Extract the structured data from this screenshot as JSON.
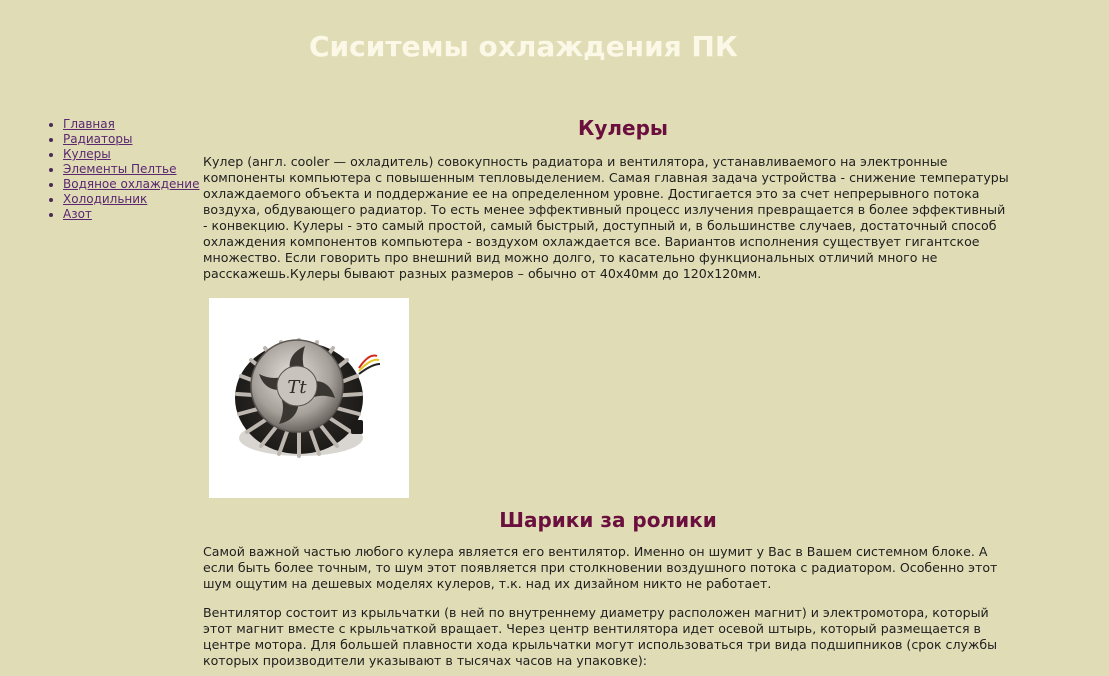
{
  "header": {
    "title": "Сиситемы охлаждения ПК"
  },
  "nav": {
    "items": [
      {
        "label": "Главная"
      },
      {
        "label": "Радиаторы"
      },
      {
        "label": "Кулеры"
      },
      {
        "label": "Элементы Пелтье"
      },
      {
        "label": "Водяное охлаждение"
      },
      {
        "label": "Холодильник"
      },
      {
        "label": "Азот"
      }
    ]
  },
  "main": {
    "section1": {
      "heading": "Кулеры",
      "paragraph": "Кулер (англ. cooler — охладитель) совокупность радиатора и вентилятора, устанавливаемого на электронные компоненты компьютера с повышенным тепловыделением. Самая главная задача устройства - снижение температуры охлаждаемого объекта и поддержание ее на определенном уровне. Достигается это за счет непрерывного потока воздуха, обдувающего радиатор. То есть менее эффективный процесс излучения превращается в более эффективный - конвекцию. Кулеры - это самый простой, самый быстрый, доступный и, в большинстве случаев, достаточный способ охлаждения компонентов компьютера - воздухом охлаждается все. Вариантов исполнения существует гигантское множество. Если говорить про внешний вид можно долго, то касательно функциональных отличий много не расскажешь.Кулеры бывают разных размеров – обычно от 40х40мм до 120х120мм.",
      "image_logo_text": "Tt"
    },
    "section2": {
      "heading": "Шарики за ролики",
      "paragraph1": "Самой важной частью любого кулера является его вентилятор. Именно он шумит у Вас в Вашем системном блоке. А если быть более точным, то шум этот появляется при столкновении воздушного потока с радиатором. Особенно этот шум ощутим на дешевых моделях кулеров, т.к. над их дизайном никто не работает.",
      "paragraph2": "Вентилятор состоит из крыльчатки (в ней по внутреннему диаметру расположен магнит) и электромотора, который этот магнит вместе с крыльчаткой вращает. Через центр вентилятора идет осевой штырь, который размещается в центре мотора. Для большей плавности хода крыльчатки могут использоваться три вида подшипников (срок службы которых производители указывают в тысячах часов на упаковке):"
    }
  }
}
